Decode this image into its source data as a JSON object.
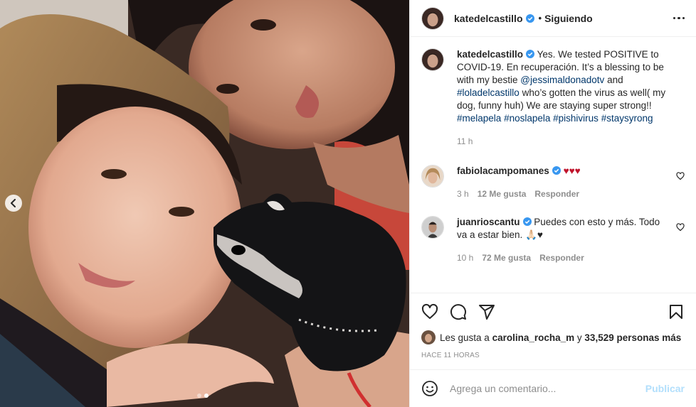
{
  "post": {
    "author": "katedelcastillo",
    "follow_state": "Siguiendo",
    "separator": "•",
    "caption": {
      "text_1": "Yes. We tested POSITIVE to COVID-19. En recuperación. It’s a blessing to be with my bestie",
      "tag_1": "@jessimaldonadotv",
      "text_2": "and",
      "tag_2": "#loladelcastillo",
      "text_3": "who’s gotten the virus as well( my dog, funny huh) We are staying super strong!!",
      "tag_3": "#melapela",
      "tag_4": "#noslapela",
      "tag_5": "#pishivirus",
      "tag_6": "#staysyrong",
      "time": "11 h"
    },
    "comments": [
      {
        "username": "fabiolacampomanes",
        "text": "♥♥♥",
        "time": "3 h",
        "likes": "12 Me gusta",
        "reply": "Responder"
      },
      {
        "username": "juanrioscantu",
        "text": "Puedes con esto y más. Todo va a estar bien. 🙏🏻♥",
        "time": "10 h",
        "likes": "72 Me gusta",
        "reply": "Responder"
      }
    ],
    "likes": {
      "prefix": "Les gusta a",
      "user": "carolina_rocha_m",
      "conj": "y",
      "count": "33,529 personas más"
    },
    "ago": "HACE 11 HORAS",
    "add_comment": {
      "placeholder": "Agrega un comentario...",
      "publish": "Publicar"
    },
    "carousel": {
      "slides": 2,
      "active": 2
    }
  },
  "colors": {
    "verified": "#3897f0",
    "link": "#00376b",
    "heart_red": "#ed4956",
    "muted": "#8e8e8e",
    "publish_disabled": "#b2dffc"
  },
  "icons": [
    "verified-badge-icon",
    "more-options-icon",
    "heart-icon",
    "comment-icon",
    "share-icon",
    "bookmark-icon",
    "emoji-icon",
    "chevron-left-icon"
  ]
}
